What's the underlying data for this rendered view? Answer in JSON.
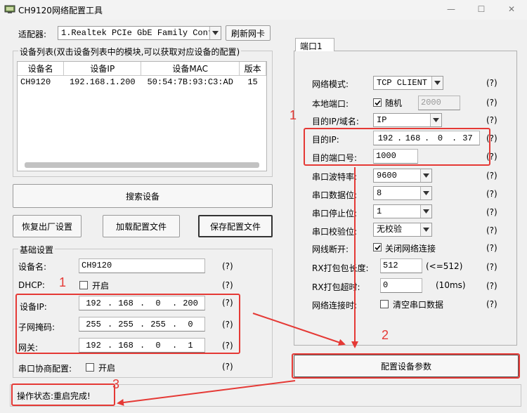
{
  "window": {
    "title": "CH9120网络配置工具",
    "minimize": "—",
    "maximize": "☐",
    "close": "✕"
  },
  "adapter": {
    "label": "适配器:",
    "selected": "1.Realtek PCIe GbE Family Controller",
    "refresh_label": "刷新网卡"
  },
  "device_list": {
    "title": "设备列表(双击设备列表中的模块,可以获取对应设备的配置)",
    "columns": [
      "设备名",
      "设备IP",
      "设备MAC",
      "版本"
    ],
    "rows": [
      {
        "name": "CH9120",
        "ip": "192.168.1.200",
        "mac": "50:54:7B:93:C3:AD",
        "version": "15"
      }
    ]
  },
  "buttons": {
    "search": "搜索设备",
    "restore": "恢复出厂设置",
    "load": "加载配置文件",
    "save": "保存配置文件",
    "apply": "配置设备参数"
  },
  "basic": {
    "title": "基础设置",
    "device_name_label": "设备名:",
    "device_name_value": "CH9120",
    "dhcp_label": "DHCP:",
    "dhcp_option": "开启",
    "ip_label": "设备IP:",
    "ip": [
      "192",
      "168",
      "0",
      "200"
    ],
    "mask_label": "子网掩码:",
    "mask": [
      "255",
      "255",
      "255",
      "0"
    ],
    "gateway_label": "网关:",
    "gateway": [
      "192",
      "168",
      "0",
      "1"
    ],
    "serial_neg_label": "串口协商配置:",
    "serial_neg_option": "开启",
    "help": "(?)"
  },
  "port": {
    "tab_label": "端口1",
    "mode_label": "网络模式:",
    "mode_value": "TCP CLIENT",
    "local_port_label": "本地端口:",
    "random_label": "随机",
    "local_port_value": "2000",
    "dest_type_label": "目的IP/域名:",
    "dest_type_value": "IP",
    "dest_ip_label": "目的IP:",
    "dest_ip": [
      "192",
      "168",
      "0",
      "37"
    ],
    "dest_port_label": "目的端口号:",
    "dest_port_value": "1000",
    "baud_label": "串口波特率:",
    "baud_value": "9600",
    "databits_label": "串口数据位:",
    "databits_value": "8",
    "stopbits_label": "串口停止位:",
    "stopbits_value": "1",
    "parity_label": "串口校验位:",
    "parity_value": "无校验",
    "disconnect_label": "网线断开:",
    "disconnect_option": "关闭网络连接",
    "rx_len_label": "RX打包包长度:",
    "rx_len_value": "512",
    "rx_len_hint": "(<=512)",
    "rx_timeout_label": "RX打包超时:",
    "rx_timeout_value": "0",
    "rx_timeout_hint": "(10ms)",
    "connect_label": "网络连接时:",
    "connect_option": "清空串口数据"
  },
  "status": {
    "text": "操作状态:重启完成!"
  },
  "annotations": {
    "n1_left": "1",
    "n1_right": "1",
    "n2": "2",
    "n3": "3"
  },
  "colors": {
    "annotation_red": "#e53935"
  }
}
